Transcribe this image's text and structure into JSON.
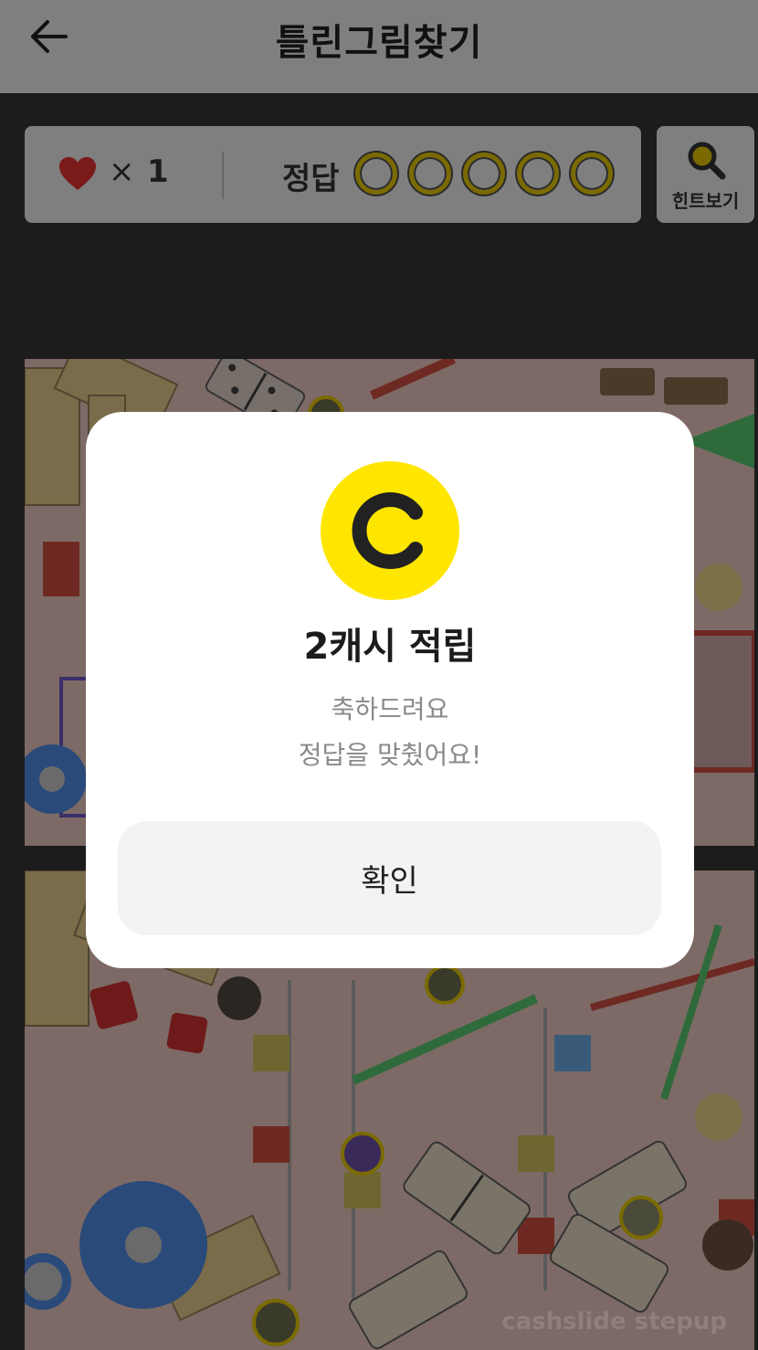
{
  "header": {
    "title": "틀린그림찾기",
    "back_icon": "arrow-left-icon"
  },
  "status": {
    "lives_symbol": "×",
    "lives_count": "1",
    "answer_label": "정답",
    "answer_slots": 5,
    "answered": 0
  },
  "hint": {
    "label": "힌트보기",
    "icon": "magnifier-icon"
  },
  "images": {
    "watermark": "cashslide stepup"
  },
  "modal": {
    "coin_letter": "C",
    "title": "2캐시 적립",
    "message_line1": "축하드려요",
    "message_line2": "정답을 맞췄어요!",
    "confirm_label": "확인"
  },
  "colors": {
    "accent_yellow": "#ffe600",
    "heart_red": "#7a1a1a",
    "overlay_gray": "#7f7f7f"
  }
}
